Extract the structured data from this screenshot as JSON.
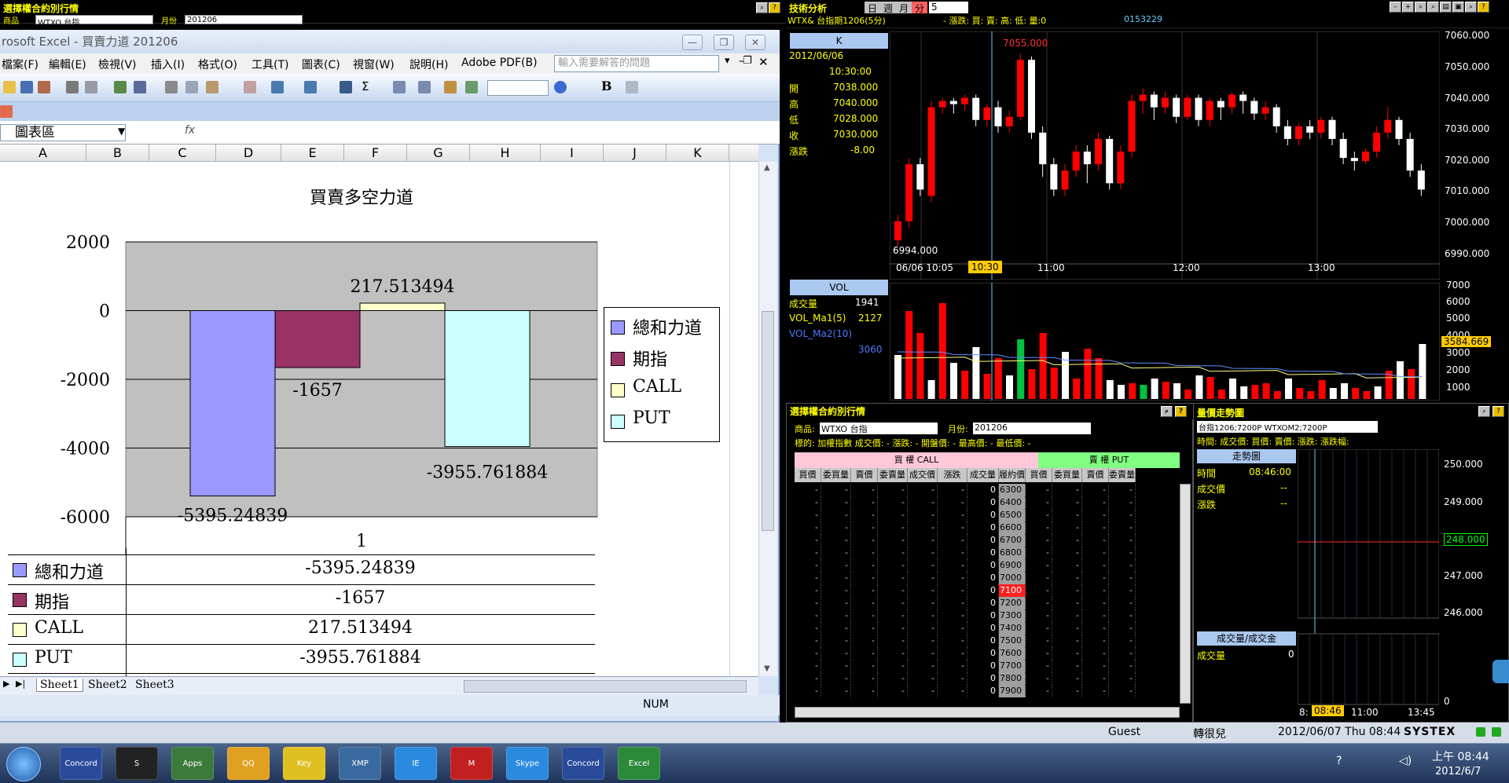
{
  "topstrip": {
    "title": "選擇權合約別行情",
    "row_label": "商品",
    "product": "WTXO 台指",
    "month_label": "月份",
    "month": "201206"
  },
  "excel": {
    "title": "rosoft Excel - 買賣力道 201206",
    "menu": [
      "檔案(F)",
      "編輯(E)",
      "檢視(V)",
      "插入(I)",
      "格式(O)",
      "工具(T)",
      "圖表(C)",
      "視窗(W)",
      "說明(H)",
      "Adobe PDF(B)"
    ],
    "ask_placeholder": "輸入需要解答的問題",
    "name_box": "圖表區",
    "fx": "fx",
    "bold_label": "B",
    "columns": [
      "A",
      "B",
      "C",
      "D",
      "E",
      "F",
      "G",
      "H",
      "I",
      "J",
      "K"
    ],
    "sheet_tabs": [
      "Sheet1",
      "Sheet2",
      "Sheet3"
    ],
    "status_num": "NUM"
  },
  "chart_data": {
    "type": "bar",
    "title": "買賣多空力道",
    "categories": [
      "1"
    ],
    "series": [
      {
        "name": "總和力道",
        "values": [
          -5395.24839
        ],
        "color": "#9999ff",
        "label": "-5395.24839"
      },
      {
        "name": "期指",
        "values": [
          -1657
        ],
        "color": "#993366",
        "label": "-1657"
      },
      {
        "name": "CALL",
        "values": [
          217.513494
        ],
        "color": "#ffffcc",
        "label": "217.513494"
      },
      {
        "name": "PUT",
        "values": [
          -3955.761884
        ],
        "color": "#ccffff",
        "label": "-3955.761884"
      }
    ],
    "yticks": [
      "2000",
      "0",
      "-2000",
      "-4000",
      "-6000"
    ],
    "ylim": [
      -6000,
      2000
    ],
    "legend": "right",
    "table": {
      "rows": [
        {
          "name": "總和力道",
          "value": "-5395.24839"
        },
        {
          "name": "期指",
          "value": "-1657"
        },
        {
          "name": "CALL",
          "value": "217.513494"
        },
        {
          "name": "PUT",
          "value": "-3955.761884"
        }
      ]
    }
  },
  "tech": {
    "title": "技術分析",
    "period_buttons": [
      "日",
      "週",
      "月",
      "分"
    ],
    "period_value": "5",
    "symbol_line": "WTX& 台指期1206(5分)",
    "quote_fields": "- 漲跌: 買: 賣: 高: 低: 量:0",
    "code": "0153229",
    "k_label": "K",
    "date": "2012/06/06",
    "time": "10:30:00",
    "ohlc": [
      {
        "k": "開",
        "v": "7038.000"
      },
      {
        "k": "高",
        "v": "7040.000"
      },
      {
        "k": "低",
        "v": "7028.000"
      },
      {
        "k": "收",
        "v": "7030.000"
      },
      {
        "k": "漲跌",
        "v": "-8.00"
      }
    ],
    "high_mark": "7055.000",
    "low_mark": "6994.000",
    "price_axis": [
      "7060.000",
      "7050.000",
      "7040.000",
      "7030.000",
      "7020.000",
      "7010.000",
      "7000.000",
      "6990.000"
    ],
    "time_axis": [
      "06/06 10:05",
      "10:30",
      "11:00",
      "12:00",
      "13:00"
    ],
    "vol_label": "VOL",
    "vol_lines": [
      {
        "k": "成交量",
        "v": "1941"
      },
      {
        "k": "VOL_Ma1(5)",
        "v": "2127"
      },
      {
        "k": "VOL_Ma2(10)",
        "v": "3060"
      }
    ],
    "vol_axis": [
      "7000",
      "6000",
      "5000",
      "4000",
      "3000",
      "2000",
      "1000"
    ],
    "vol_mark": "3584.669"
  },
  "options": {
    "title": "選擇權合約別行情",
    "product_label": "商品:",
    "product": "WTXO 台指",
    "month_label": "月份:",
    "month": "201206",
    "info": "標的: 加權指數  成交價: -  漲跌: -  開盤價: -  最高價: -  最低價: -",
    "call_label": "買 權 CALL",
    "put_label": "賣 權 PUT",
    "headers": [
      "買價",
      "委買量",
      "賣價",
      "委賣量",
      "成交價",
      "漲跌",
      "成交量",
      "履約價",
      "買價",
      "委買量",
      "賣價",
      "委賣量"
    ],
    "strikes": [
      "6300",
      "6400",
      "6500",
      "6600",
      "6700",
      "6800",
      "6900",
      "7000",
      "7100",
      "7200",
      "7300",
      "7400",
      "7500",
      "7600",
      "7700",
      "7800",
      "7900"
    ],
    "vol_zero": "0",
    "dash": "-"
  },
  "quote": {
    "title": "量價走勢圖",
    "select": "台指1206;7200P  WTXOM2;7200P",
    "fields": "時間: 成交價: 買價: 賣價: 漲跌: 漲跌幅:",
    "trend_label": "走勢圖",
    "rows": [
      {
        "k": "時間",
        "v": "08:46:00"
      },
      {
        "k": "成交價",
        "v": "--"
      },
      {
        "k": "漲跌",
        "v": "--"
      }
    ],
    "price_axis": [
      "250.000",
      "249.000",
      "248.000",
      "247.000",
      "246.000"
    ],
    "vol_label": "成交量/成交金",
    "vol_row": {
      "k": "成交量",
      "v": "0"
    },
    "vol_axis_zero": "0",
    "time_axis": [
      "8:",
      "08:46",
      "11:00",
      "13:45"
    ]
  },
  "status": {
    "user": "Guest",
    "name": "轉很兒",
    "datetime": "2012/06/07 Thu 08:44",
    "brand": "SYSTEX"
  },
  "taskbar": {
    "clock_time": "上午 08:44",
    "clock_date": "2012/6/7",
    "apps": [
      "Concord",
      "S",
      "Apps",
      "QQ",
      "Key",
      "XMP",
      "IE",
      "M",
      "Skype",
      "Concord",
      "Excel"
    ]
  },
  "colors": {
    "excel_chrome": "#d6e3f6",
    "up": "#ff0000",
    "down": "#ffffff",
    "accent": "#ffff00"
  }
}
